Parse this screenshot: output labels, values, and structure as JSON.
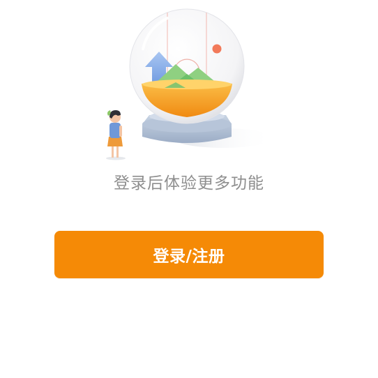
{
  "empty_state": {
    "illustration_icon": "snow-globe-illustration",
    "message": "登录后体验更多功能"
  },
  "actions": {
    "login_register_label": "登录/注册"
  },
  "colors": {
    "accent": "#f58a06",
    "message_text": "#8e8e8e",
    "background": "#ffffff"
  }
}
